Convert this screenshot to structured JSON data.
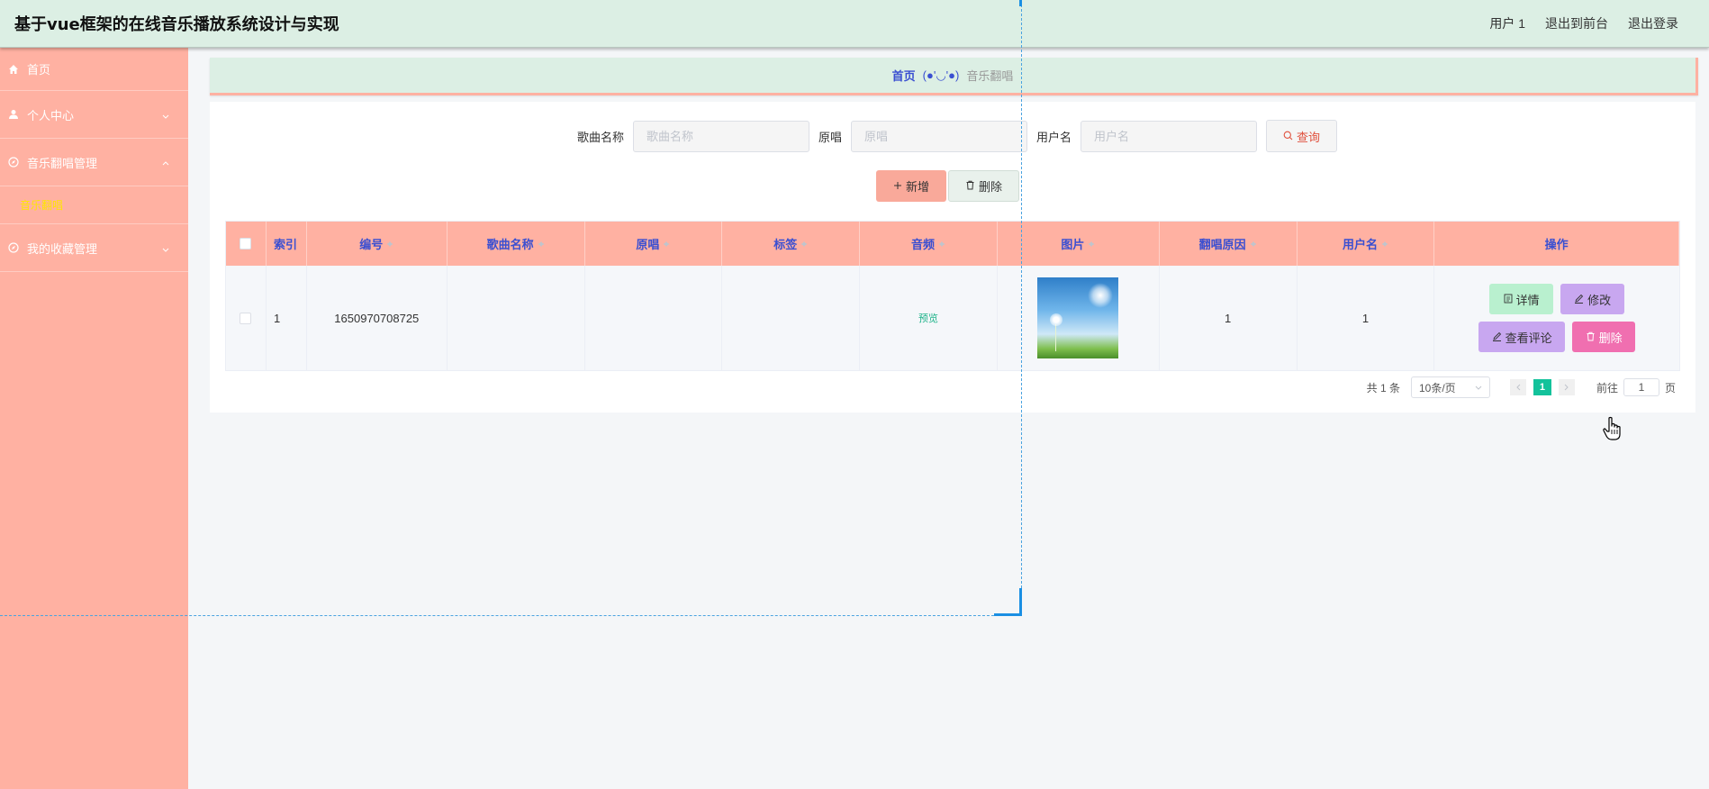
{
  "header": {
    "title": "基于vue框架的在线音乐播放系统设计与实现",
    "user": "用户 1",
    "to_front": "退出到前台",
    "logout": "退出登录"
  },
  "sidebar": {
    "items": [
      {
        "label": "首页",
        "icon": "home-icon"
      },
      {
        "label": "个人中心",
        "icon": "user-icon"
      },
      {
        "label": "音乐翻唱管理",
        "icon": "compass-icon",
        "expanded": true
      },
      {
        "label": "音乐翻唱",
        "sub": true,
        "active": true
      },
      {
        "label": "我的收藏管理",
        "icon": "compass-icon"
      }
    ]
  },
  "breadcrumb": {
    "home": "首页",
    "separator": "(●'◡'●)",
    "current": "音乐翻唱"
  },
  "search": {
    "song_label": "歌曲名称",
    "song_placeholder": "歌曲名称",
    "orig_label": "原唱",
    "orig_placeholder": "原唱",
    "user_label": "用户名",
    "user_placeholder": "用户名",
    "query_label": "查询"
  },
  "actions": {
    "add_label": "新增",
    "delete_label": "删除"
  },
  "table": {
    "columns": [
      "索引",
      "编号",
      "歌曲名称",
      "原唱",
      "标签",
      "音频",
      "图片",
      "翻唱原因",
      "用户名",
      "操作"
    ],
    "rows": [
      {
        "index": "1",
        "number": "1650970708725",
        "song": "",
        "original": "",
        "tag": "",
        "audio": "预览",
        "reason": "1",
        "user": "1"
      }
    ],
    "ops": {
      "detail": "详情",
      "edit": "修改",
      "comments": "查看评论",
      "delete": "删除"
    }
  },
  "pagination": {
    "total": "共 1 条",
    "page_size": "10条/页",
    "current_page": "1",
    "goto_prefix": "前往",
    "goto_value": "1",
    "goto_suffix": "页"
  },
  "colors": {
    "header_bg": "#dcefe4",
    "sidebar_bg": "#ffb1a2",
    "table_head_bg": "#ffb1a2",
    "accent_blue": "#3a4fd1",
    "active_sub": "#ffe600"
  }
}
